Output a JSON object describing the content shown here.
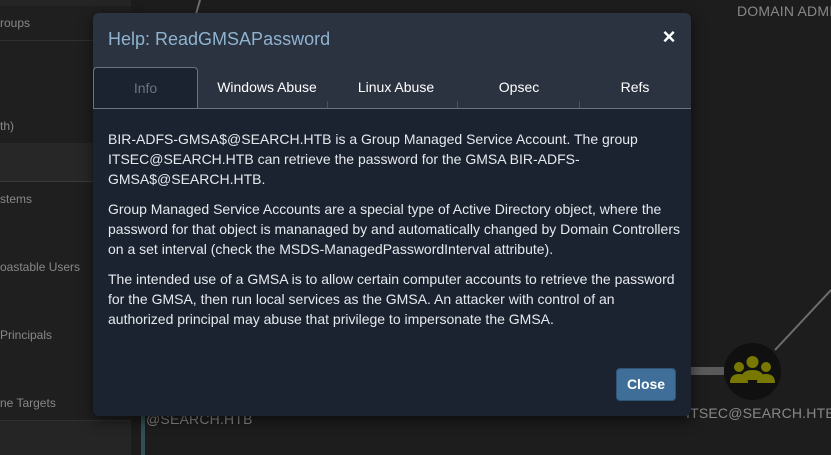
{
  "sidebar": {
    "items": [
      {
        "label": "roups"
      },
      {
        "label": ""
      },
      {
        "label": ""
      },
      {
        "label": "th)"
      },
      {
        "label": ""
      },
      {
        "label": "stems"
      },
      {
        "label": ""
      },
      {
        "label": "oastable Users"
      },
      {
        "label": ""
      },
      {
        "label": "Principals"
      },
      {
        "label": ""
      },
      {
        "label": "ne Targets"
      }
    ]
  },
  "graph": {
    "top_right_label": "DOMAIN ADMI",
    "bottom_left_label": "@SEARCH.HTB",
    "group_node_label": "ITSEC@SEARCH.HTB",
    "group_node_icon": "group-icon",
    "group_node_color": "#b8b800"
  },
  "modal": {
    "title": "Help: ReadGMSAPassword",
    "close_icon": "close-icon",
    "tabs": [
      {
        "label": "Info",
        "active": true
      },
      {
        "label": "Windows Abuse",
        "active": false
      },
      {
        "label": "Linux Abuse",
        "active": false
      },
      {
        "label": "Opsec",
        "active": false
      },
      {
        "label": "Refs",
        "active": false
      }
    ],
    "paragraphs": [
      "BIR-ADFS-GMSA$@SEARCH.HTB is a Group Managed Service Account. The group ITSEC@SEARCH.HTB can retrieve the password for the GMSA BIR-ADFS-GMSA$@SEARCH.HTB.",
      "Group Managed Service Accounts are a special type of Active Directory object, where the password for that object is mananaged by and automatically changed by Domain Controllers on a set interval (check the MSDS-ManagedPasswordInterval attribute).",
      "The intended use of a GMSA is to allow certain computer accounts to retrieve the password for the GMSA, then run local services as the GMSA. An attacker with control of an authorized principal may abuse that privilege to impersonate the GMSA."
    ],
    "close_button_label": "Close",
    "accent_color": "#3f6f98"
  }
}
